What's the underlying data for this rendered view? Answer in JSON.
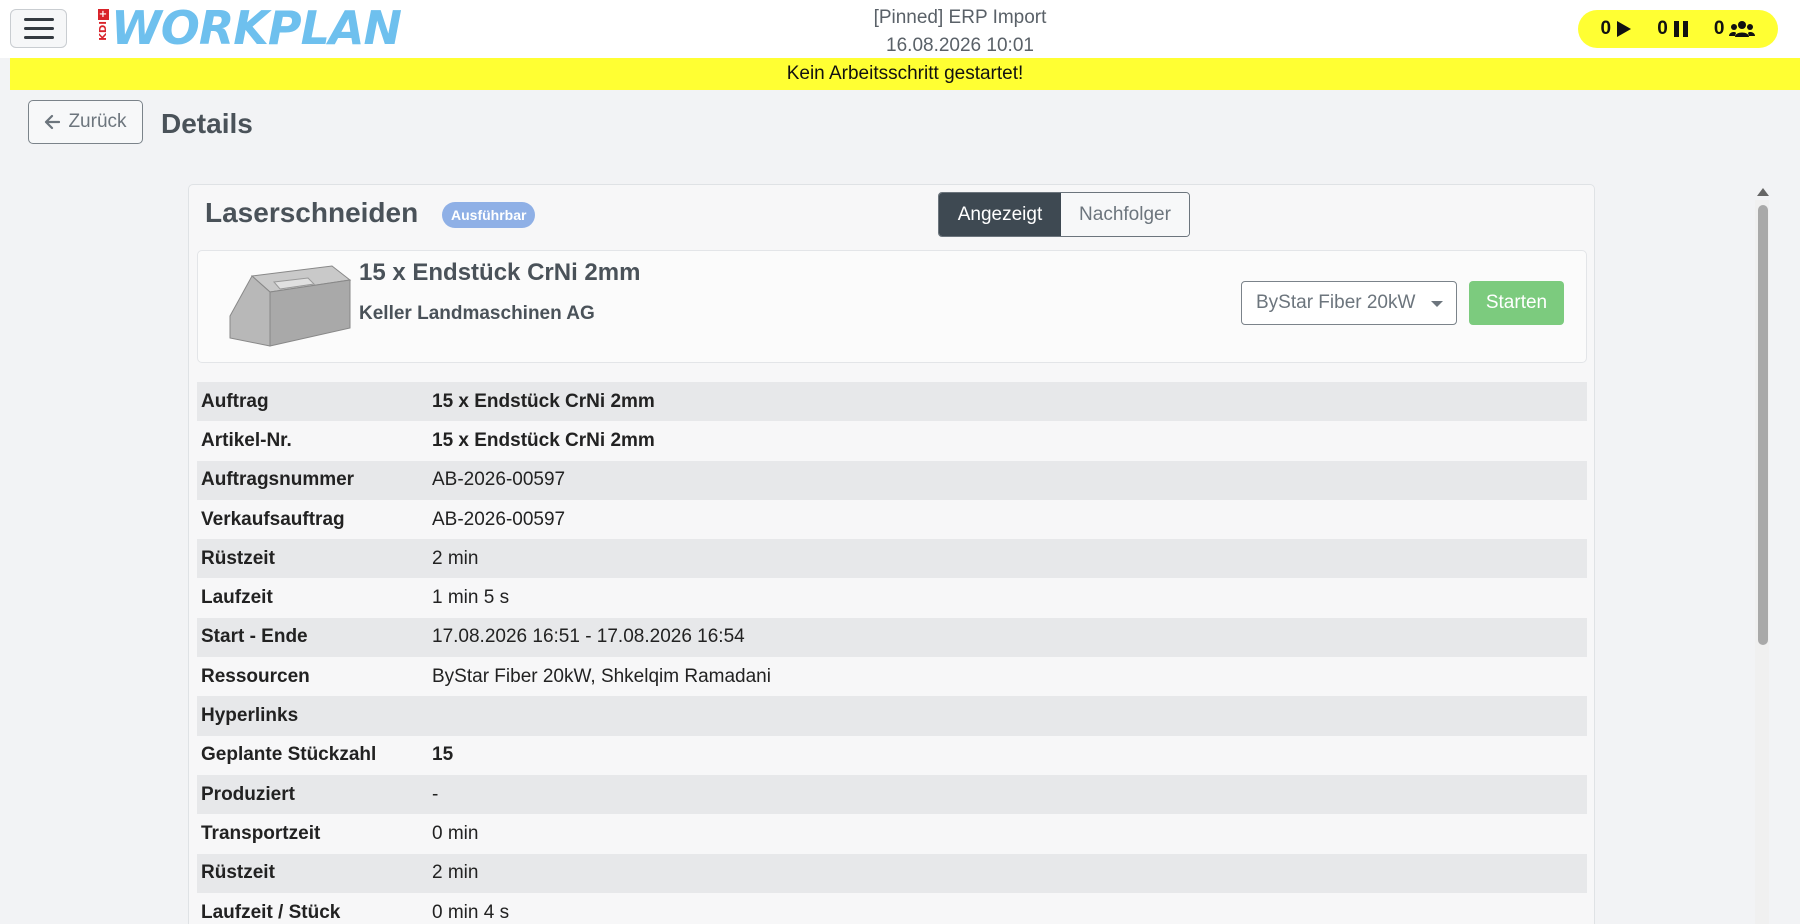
{
  "header": {
    "logo_badge": "KDI",
    "logo_text": "WORKPLAN",
    "title_line1": "[Pinned] ERP Import",
    "title_line2": "16.08.2026 10:01",
    "status": {
      "running_count": "0",
      "paused_count": "0",
      "users_count": "0"
    }
  },
  "banner": {
    "text": "Kein Arbeitsschritt gestartet!",
    "color": "#ffff33"
  },
  "page": {
    "back_label": "Zurück",
    "title": "Details"
  },
  "operation": {
    "name": "Laserschneiden",
    "status_badge": "Ausführbar",
    "toggle": {
      "active": "Angezeigt",
      "inactive": "Nachfolger"
    }
  },
  "product": {
    "name": "15 x Endstück CrNi 2mm",
    "customer": "Keller Landmaschinen AG",
    "resource_selected": "ByStar Fiber 20kW",
    "start_label": "Starten"
  },
  "details": [
    {
      "label": "Auftrag",
      "value": "15 x Endstück CrNi 2mm"
    },
    {
      "label": "Artikel-Nr.",
      "value": "15 x Endstück CrNi 2mm"
    },
    {
      "label": "Auftragsnummer",
      "value": "AB-2026-00597"
    },
    {
      "label": "Verkaufsauftrag",
      "value": "AB-2026-00597"
    },
    {
      "label": "Rüstzeit",
      "value": "2 min"
    },
    {
      "label": "Laufzeit",
      "value": "1 min 5 s"
    },
    {
      "label": "Start - Ende",
      "value": "17.08.2026 16:51 - 17.08.2026 16:54"
    },
    {
      "label": "Ressourcen",
      "value": "ByStar Fiber 20kW, Shkelqim Ramadani"
    },
    {
      "label": "Hyperlinks",
      "value": ""
    },
    {
      "label": "Geplante Stückzahl",
      "value": "15"
    },
    {
      "label": "Produziert",
      "value": "-"
    },
    {
      "label": "Transportzeit",
      "value": "0 min"
    },
    {
      "label": "Rüstzeit",
      "value": "2 min"
    },
    {
      "label": "Laufzeit / Stück",
      "value": "0 min 4 s"
    }
  ],
  "colors": {
    "accent_blue": "#6ec0ee",
    "badge": "#8fb0e6",
    "start_green": "#7ccb7e",
    "toggle_active": "#3e4952"
  }
}
